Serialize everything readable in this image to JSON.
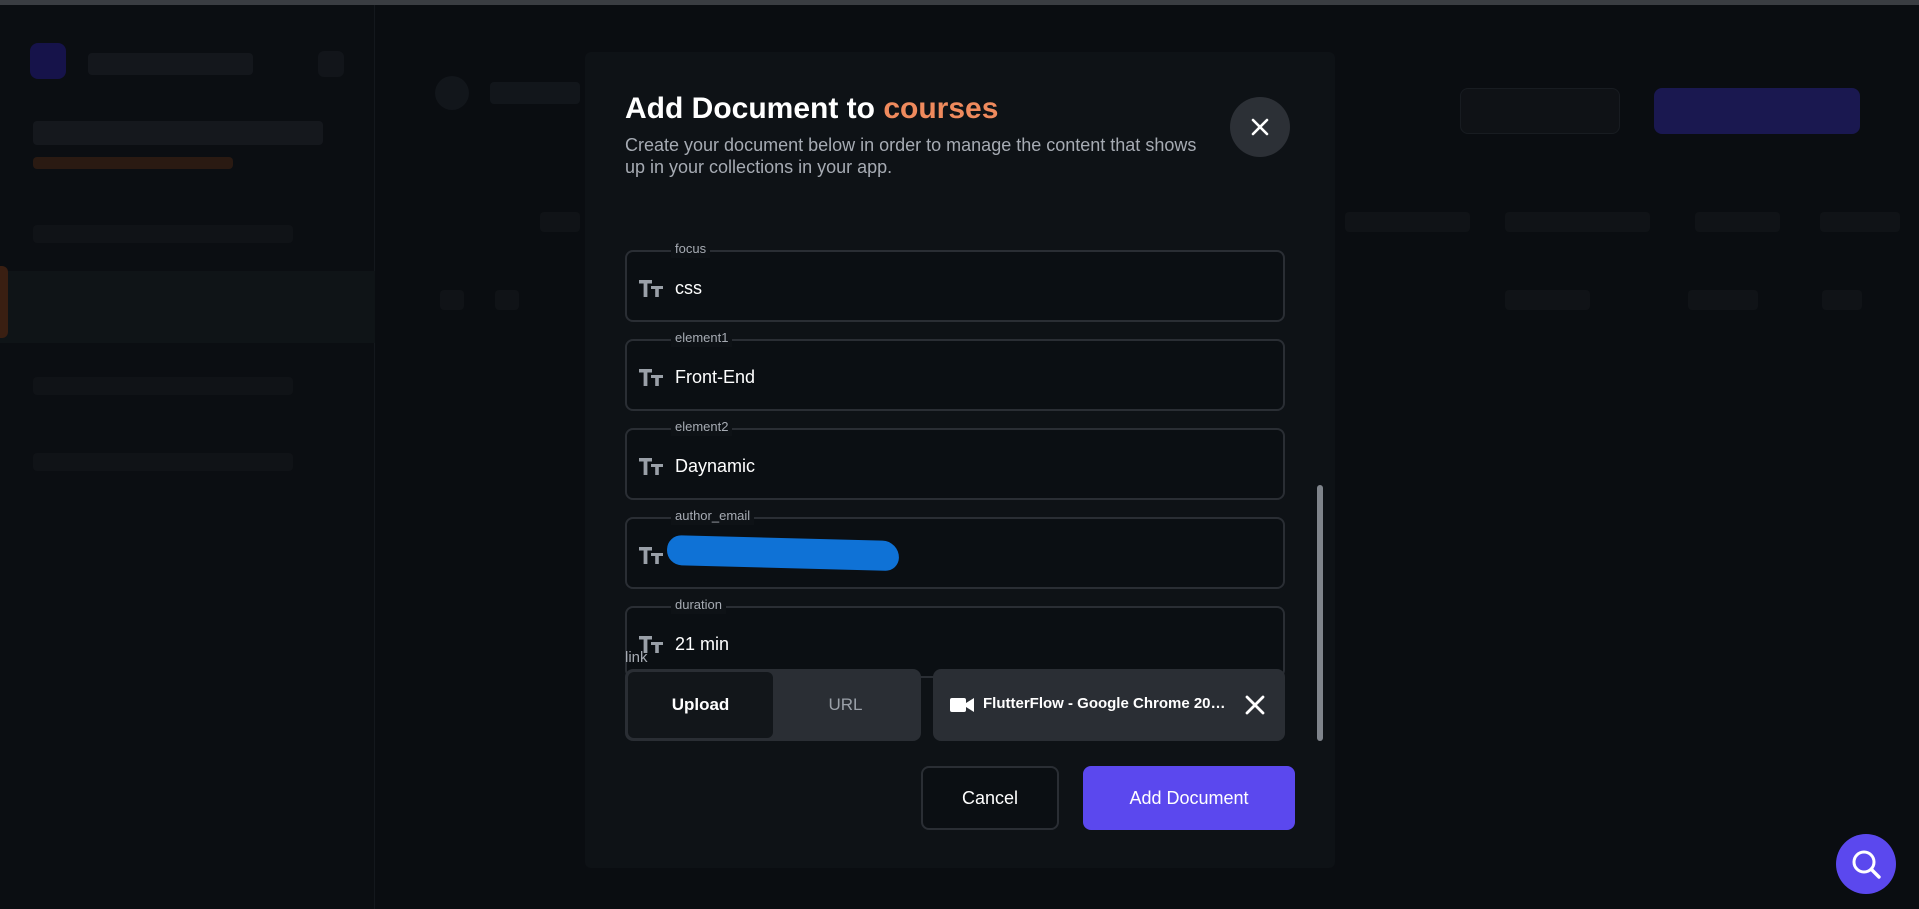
{
  "modal": {
    "title_prefix": "Add Document to",
    "title_collection": "courses",
    "description": "Create your document below in order to manage the content that shows up in your collections in your app.",
    "fields": [
      {
        "label": "focus",
        "value": "css",
        "icon": "text-type-icon"
      },
      {
        "label": "element1",
        "value": "Front-End",
        "icon": "text-type-icon"
      },
      {
        "label": "element2",
        "value": "Daynamic",
        "icon": "text-type-icon"
      },
      {
        "label": "author_email",
        "value": "",
        "icon": "text-type-icon",
        "redacted": true
      },
      {
        "label": "duration",
        "value": "21 min",
        "icon": "text-type-icon"
      }
    ],
    "link": {
      "label": "link",
      "toggle": {
        "options": [
          "Upload",
          "URL"
        ],
        "selected": "Upload"
      },
      "file_name": "FlutterFlow - Google Chrome 2024-..."
    },
    "buttons": {
      "cancel": "Cancel",
      "add": "Add Document"
    }
  },
  "colors": {
    "accent_orange": "#ef8a5d",
    "primary": "#5b48ee",
    "redaction": "#0f72d6"
  }
}
